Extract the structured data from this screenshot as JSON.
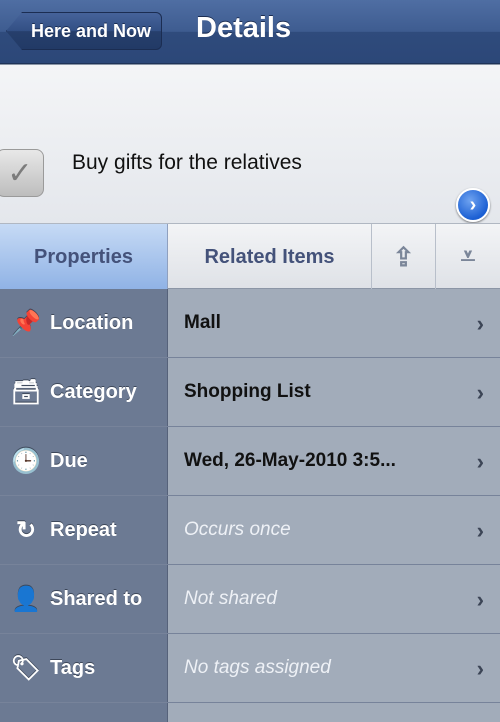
{
  "navbar": {
    "back_label": "Here and Now",
    "title": "Details"
  },
  "task": {
    "title": "Buy gifts for the relatives"
  },
  "tabs": {
    "properties": "Properties",
    "related": "Related Items"
  },
  "rows": [
    {
      "label": "Location",
      "value": "Mall",
      "placeholder": false,
      "icon": "pin-icon"
    },
    {
      "label": "Category",
      "value": "Shopping List",
      "placeholder": false,
      "icon": "inbox-icon"
    },
    {
      "label": "Due",
      "value": "Wed, 26-May-2010 3:5...",
      "placeholder": false,
      "icon": "clock-icon"
    },
    {
      "label": "Repeat",
      "value": "Occurs once",
      "placeholder": true,
      "icon": "repeat-icon"
    },
    {
      "label": "Shared to",
      "value": "Not shared",
      "placeholder": true,
      "icon": "person-icon"
    },
    {
      "label": "Tags",
      "value": "No tags assigned",
      "placeholder": true,
      "icon": "tag-icon"
    }
  ]
}
